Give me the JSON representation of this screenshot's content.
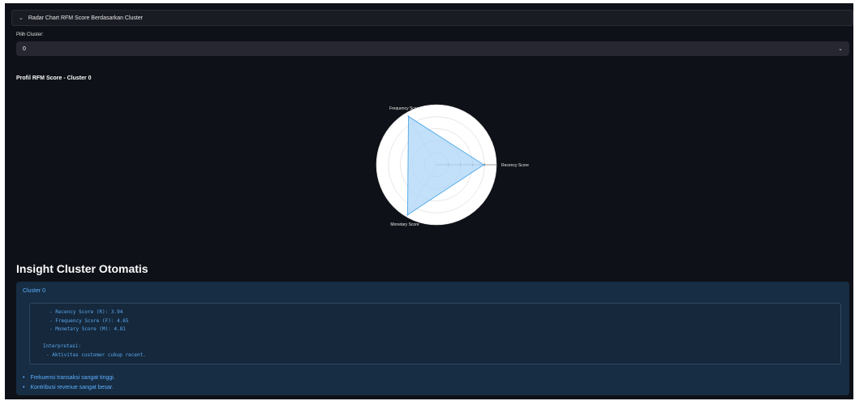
{
  "expander": {
    "title": "Radar Chart RFM Score Berdasarkan Cluster"
  },
  "select": {
    "label": "Pilih Cluster:",
    "value": "0"
  },
  "chart_title": "Profil RFM Score - Cluster 0",
  "chart_data": {
    "type": "radar",
    "axes": [
      "Recency Score",
      "Frequency Score",
      "Monetary Score"
    ],
    "series": [
      {
        "values": [
          3.94,
          4.65,
          4.81
        ]
      }
    ],
    "range": [
      0,
      5
    ],
    "grid": true,
    "colors": {
      "fill": "#aed6f7",
      "stroke": "#5aaee8",
      "background": "#ffffff",
      "grid": "#d0d0d0"
    }
  },
  "insight": {
    "heading": "Insight Cluster Otomatis",
    "cluster_title": "Cluster 0",
    "code_lines": [
      "- Recency Score (R): 3.94",
      "- Frequency Score (F): 4.65",
      "- Monetary Score (M): 4.81",
      "",
      "Interpretasi:",
      "- Aktivitas customer cukup recent."
    ],
    "bullets": [
      "Frekuensi transaksi sangat tinggi.",
      "Kontribusi revenue sangat besar."
    ]
  },
  "icons": {
    "expander": "chevron-down-icon",
    "select": "chevron-down-icon"
  },
  "colors": {
    "background": "#0e1117",
    "panel": "#262730",
    "insight_bg": "#172d43",
    "insight_text": "#5cb0ff"
  }
}
